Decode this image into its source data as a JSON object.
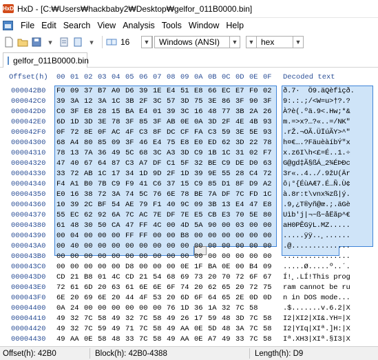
{
  "window": {
    "title": "HxD - [C:₩Users₩hackbaby2₩Desktop₩gelfor_011B0000.bin]",
    "app_icon": "hxd-icon",
    "app_badge": "HxD"
  },
  "menu": {
    "icon": "file-icon",
    "items": [
      "File",
      "Edit",
      "Search",
      "View",
      "Analysis",
      "Tools",
      "Window",
      "Help"
    ]
  },
  "toolbar": {
    "bytes_per_row": "16",
    "charset": "Windows (ANSI)",
    "offset_base": "hex",
    "buttons": [
      "new-file-icon",
      "open-file-icon",
      "save-icon",
      "save-dropdown-icon",
      "properties-icon",
      "document-icon",
      "dropdown-icon",
      "columns-icon"
    ]
  },
  "tab": {
    "label": "gelfor_011B0000.bin"
  },
  "editor": {
    "offset_header": "Offset(h)",
    "column_headers": [
      "00",
      "01",
      "02",
      "03",
      "04",
      "05",
      "06",
      "07",
      "08",
      "09",
      "0A",
      "0B",
      "0C",
      "0D",
      "0E",
      "0F"
    ],
    "decoded_header": "Decoded text",
    "rows": [
      {
        "offset": "000042B0",
        "bytes": [
          "F0",
          "09",
          "37",
          "B7",
          "A0",
          "D6",
          "39",
          "1E",
          "E4",
          "51",
          "E8",
          "66",
          "EC",
          "E7",
          "F0",
          "02"
        ],
        "text": "ð.7·  Ö9.äQèfìçð."
      },
      {
        "offset": "000042C0",
        "bytes": [
          "39",
          "3A",
          "12",
          "3A",
          "1C",
          "3B",
          "2F",
          "3C",
          "57",
          "3D",
          "75",
          "3E",
          "86",
          "3F",
          "90",
          "3F"
        ],
        "text": "9:.:.;/<W=u>†?.?"
      },
      {
        "offset": "000042D0",
        "bytes": [
          "C0",
          "3F",
          "E8",
          "28",
          "15",
          "BA",
          "E4",
          "01",
          "39",
          "3C",
          "16",
          "48",
          "77",
          "3B",
          "2A",
          "26"
        ],
        "text": "À?è(.ºä.9<.Hw;*&"
      },
      {
        "offset": "000042E0",
        "bytes": [
          "6D",
          "1D",
          "3D",
          "3E",
          "78",
          "3F",
          "85",
          "3F",
          "AB",
          "0E",
          "0A",
          "3D",
          "2F",
          "4E",
          "4B",
          "93"
        ],
        "text": "m.=>x?…?«..=/NK\""
      },
      {
        "offset": "000042F0",
        "bytes": [
          "0F",
          "72",
          "8E",
          "0F",
          "AC",
          "4F",
          "C3",
          "8F",
          "DC",
          "CF",
          "FA",
          "C3",
          "59",
          "3E",
          "5E",
          "93"
        ],
        "text": ".rŽ.¬OÃ.ÜÏúÃY>^\""
      },
      {
        "offset": "00004300",
        "bytes": [
          "68",
          "A4",
          "80",
          "85",
          "09",
          "3F",
          "46",
          "E4",
          "75",
          "E8",
          "E0",
          "ED",
          "62",
          "3D",
          "22",
          "78"
        ],
        "text": "h¤€….?FäuèàíbÝ\"x"
      },
      {
        "offset": "00004310",
        "bytes": [
          "78",
          "13",
          "7A",
          "36",
          "49",
          "5C",
          "68",
          "3C",
          "A3",
          "3D",
          "C9",
          "1B",
          "1C",
          "31",
          "02",
          "F7"
        ],
        "text": "x.z6I\\h<£=É..1.÷"
      },
      {
        "offset": "00004320",
        "bytes": [
          "47",
          "40",
          "67",
          "64",
          "87",
          "C3",
          "A7",
          "DF",
          "C1",
          "5F",
          "32",
          "BE",
          "C9",
          "DE",
          "D0",
          "63"
        ],
        "text": "G@gd‡Ã§ßÁ_2¾ÉÞÐc"
      },
      {
        "offset": "00004330",
        "bytes": [
          "33",
          "72",
          "AB",
          "1C",
          "17",
          "34",
          "1D",
          "9D",
          "2F",
          "1D",
          "39",
          "9E",
          "55",
          "28",
          "C4",
          "72"
        ],
        "text": "3r«..4../.9žU(Är"
      },
      {
        "offset": "00004340",
        "bytes": [
          "F4",
          "A1",
          "B0",
          "7B",
          "C9",
          "F9",
          "41",
          "C6",
          "37",
          "15",
          "C9",
          "85",
          "D1",
          "8F",
          "D9",
          "A2"
        ],
        "text": "ô¡°{ÉùAÆ7.É…Ñ.Ù¢"
      },
      {
        "offset": "00004350",
        "bytes": [
          "E0",
          "16",
          "38",
          "72",
          "3A",
          "74",
          "5C",
          "76",
          "6E",
          "78",
          "BE",
          "7A",
          "DF",
          "7C",
          "FD",
          "1C"
        ],
        "text": "à.8r:t\\vnx¾zß|ý."
      },
      {
        "offset": "00004360",
        "bytes": [
          "10",
          "39",
          "2C",
          "BF",
          "54",
          "AE",
          "79",
          "F1",
          "40",
          "9C",
          "09",
          "3B",
          "13",
          "E4",
          "47",
          "E8"
        ],
        "text": ".9,¿T®yñ@œ.;.äGè"
      },
      {
        "offset": "00004370",
        "bytes": [
          "55",
          "EC",
          "62",
          "92",
          "6A",
          "7C",
          "AC",
          "7E",
          "DF",
          "7E",
          "E5",
          "CB",
          "E3",
          "70",
          "5E",
          "80"
        ],
        "text": "Uìb'j|¬~ß~åËãp^€"
      },
      {
        "offset": "00004380",
        "bytes": [
          "61",
          "48",
          "30",
          "50",
          "CA",
          "47",
          "FF",
          "4C",
          "00",
          "4D",
          "5A",
          "90",
          "00",
          "03",
          "00",
          "00"
        ],
        "text": "aH0PÊGÿL.MZ....."
      },
      {
        "offset": "00004390",
        "bytes": [
          "00",
          "04",
          "00",
          "00",
          "00",
          "FF",
          "FF",
          "00",
          "00",
          "B8",
          "00",
          "00",
          "00",
          "00",
          "00",
          "00"
        ],
        "text": ".....ÿÿ..¸......"
      },
      {
        "offset": "000043A0",
        "bytes": [
          "00",
          "40",
          "00",
          "00",
          "00",
          "00",
          "00",
          "00",
          "00",
          "00",
          "00",
          "00",
          "00",
          "00",
          "00",
          "00"
        ],
        "text": ".@.............."
      },
      {
        "offset": "000043B0",
        "bytes": [
          "00",
          "00",
          "00",
          "00",
          "00",
          "00",
          "00",
          "00",
          "00",
          "00",
          "00",
          "00",
          "00",
          "00",
          "00",
          "00"
        ],
        "text": "................"
      },
      {
        "offset": "000043C0",
        "bytes": [
          "00",
          "00",
          "00",
          "00",
          "00",
          "D8",
          "00",
          "00",
          "00",
          "0E",
          "1F",
          "BA",
          "0E",
          "00",
          "B4",
          "09"
        ],
        "text": ".....Ø.....º..´."
      },
      {
        "offset": "000043D0",
        "bytes": [
          "CD",
          "21",
          "B8",
          "01",
          "4C",
          "CD",
          "21",
          "54",
          "68",
          "69",
          "73",
          "20",
          "70",
          "72",
          "6F",
          "67"
        ],
        "text": "Í!¸.LÍ!This prog"
      },
      {
        "offset": "000043E0",
        "bytes": [
          "72",
          "61",
          "6D",
          "20",
          "63",
          "61",
          "6E",
          "6E",
          "6F",
          "74",
          "20",
          "62",
          "65",
          "20",
          "72",
          "75"
        ],
        "text": "ram cannot be ru"
      },
      {
        "offset": "000043F0",
        "bytes": [
          "6E",
          "20",
          "69",
          "6E",
          "20",
          "44",
          "4F",
          "53",
          "20",
          "6D",
          "6F",
          "64",
          "65",
          "2E",
          "0D",
          "0D"
        ],
        "text": "n in DOS mode..."
      },
      {
        "offset": "00004400",
        "bytes": [
          "0A",
          "24",
          "00",
          "00",
          "00",
          "00",
          "00",
          "00",
          "76",
          "1D",
          "36",
          "1A",
          "32",
          "7C",
          "58"
        ],
        "text": ".$.......v.6.2|X"
      },
      {
        "offset": "00004410",
        "bytes": [
          "49",
          "32",
          "7C",
          "58",
          "49",
          "32",
          "7C",
          "58",
          "49",
          "26",
          "17",
          "59",
          "48",
          "3D",
          "7C",
          "58"
        ],
        "text": "I2|XI2|XI&.YH=|X"
      },
      {
        "offset": "00004420",
        "bytes": [
          "49",
          "32",
          "7C",
          "59",
          "49",
          "71",
          "7C",
          "58",
          "49",
          "AA",
          "0E",
          "5D",
          "48",
          "3A",
          "7C",
          "58"
        ],
        "text": "I2|YIq|XIª.]H:|X"
      },
      {
        "offset": "00004430",
        "bytes": [
          "49",
          "AA",
          "0E",
          "58",
          "48",
          "33",
          "7C",
          "58",
          "49",
          "AA",
          "0E",
          "A7",
          "49",
          "33",
          "7C",
          "58"
        ],
        "text": "Iª.XH3|XIª.§I3|X"
      }
    ]
  },
  "status": {
    "offset": "Offset(h): 42B0",
    "block": "Block(h): 42B0-4388",
    "length": "Length(h): D9"
  }
}
